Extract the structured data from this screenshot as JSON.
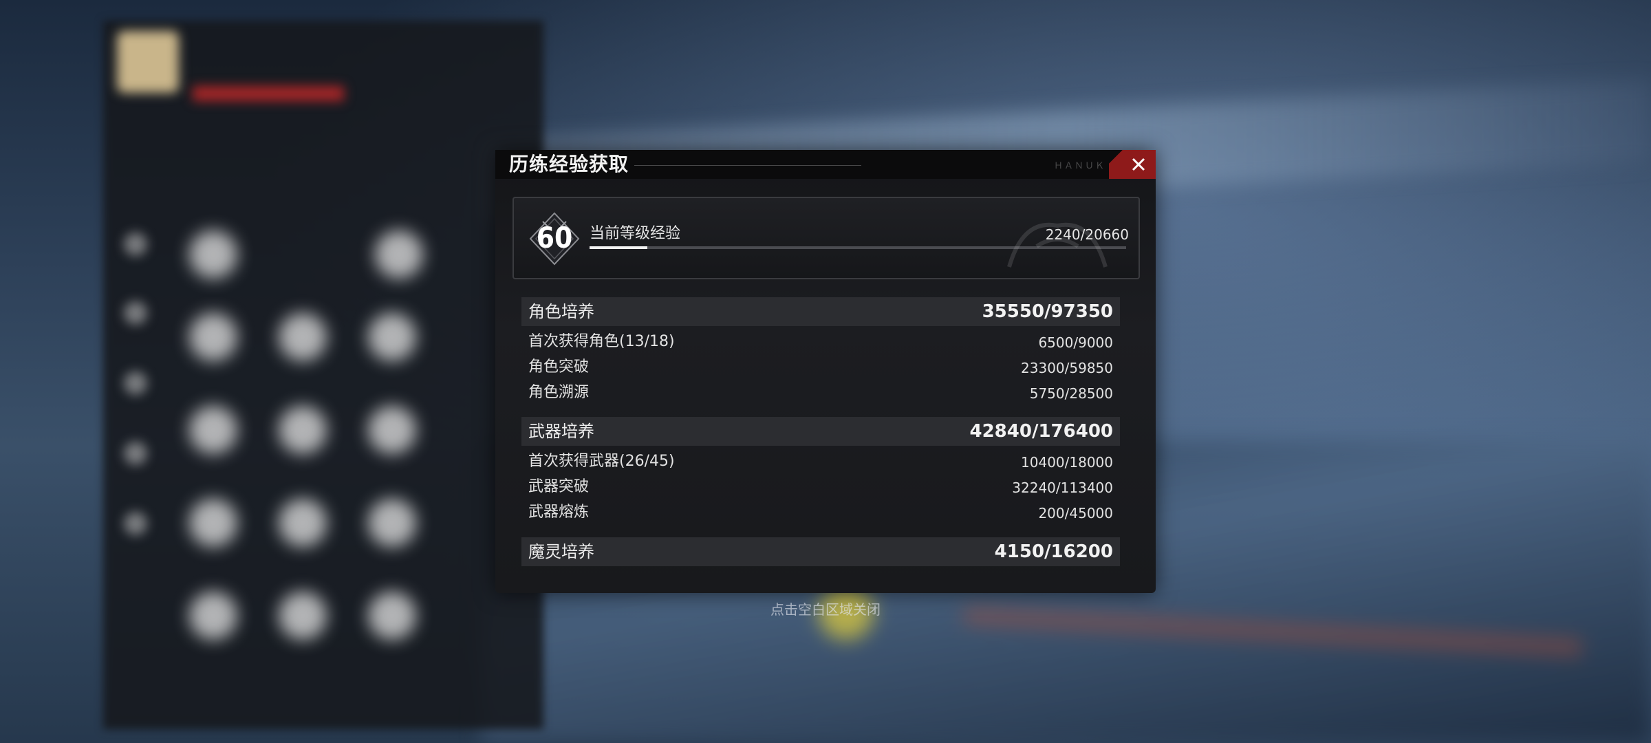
{
  "dialog": {
    "title": "历练经验获取",
    "header_deco": "ＨＡＮＵＫ"
  },
  "level": {
    "number": "60",
    "label": "当前等级经验",
    "value_text": "2240/20660",
    "progress_fraction": 0.108
  },
  "sections": [
    {
      "label": "角色培养",
      "value": "35550/97350",
      "items": [
        {
          "label": "首次获得角色(13/18)",
          "value": "6500/9000"
        },
        {
          "label": "角色突破",
          "value": "23300/59850"
        },
        {
          "label": "角色溯源",
          "value": "5750/28500"
        }
      ]
    },
    {
      "label": "武器培养",
      "value": "42840/176400",
      "items": [
        {
          "label": "首次获得武器(26/45)",
          "value": "10400/18000"
        },
        {
          "label": "武器突破",
          "value": "32240/113400"
        },
        {
          "label": "武器熔炼",
          "value": "200/45000"
        }
      ]
    },
    {
      "label": "魔灵培养",
      "value": "4150/16200",
      "items": []
    }
  ],
  "footer_hint": "点击空白区域关闭",
  "colors": {
    "close_button": "#8e1a1a",
    "section_bg": "#2c2d31",
    "dialog_bg": "#18191c"
  }
}
